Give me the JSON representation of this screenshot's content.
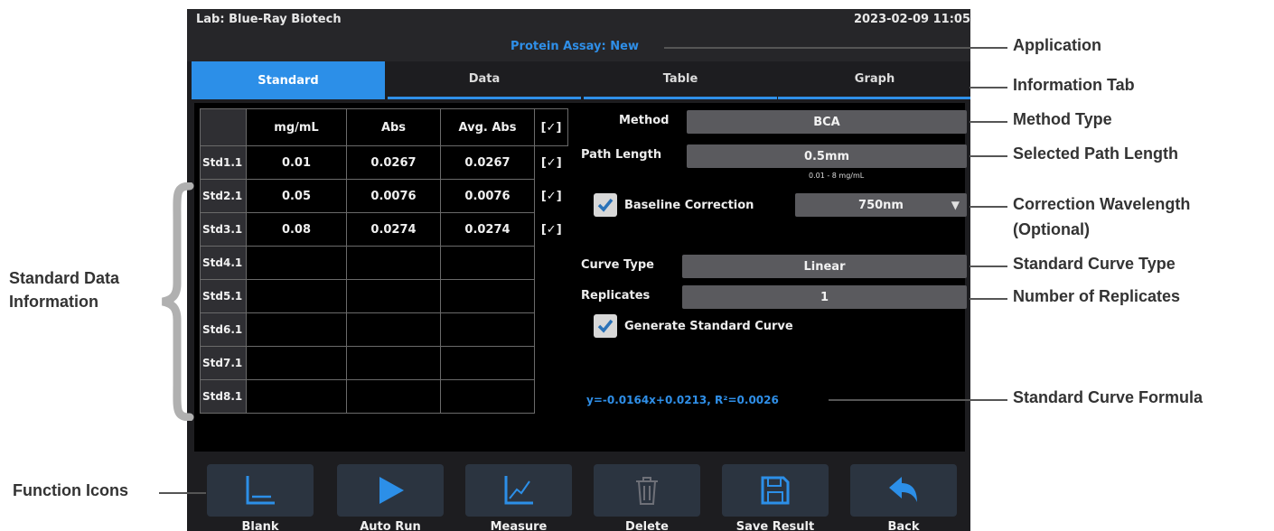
{
  "header": {
    "lab": "Lab: Blue-Ray Biotech",
    "datetime": "2023-02-09 11:05",
    "application": "Protein Assay: New"
  },
  "tabs": [
    {
      "label": "Standard",
      "active": true
    },
    {
      "label": "Data",
      "active": false
    },
    {
      "label": "Table",
      "active": false
    },
    {
      "label": "Graph",
      "active": false
    }
  ],
  "table": {
    "headers": [
      "",
      "mg/mL",
      "Abs",
      "Avg. Abs",
      "[✓]"
    ],
    "rows": [
      {
        "id": "Std1.1",
        "conc": "0.01",
        "abs": "0.0267",
        "avg": "0.0267",
        "check": "[✓]"
      },
      {
        "id": "Std2.1",
        "conc": "0.05",
        "abs": "0.0076",
        "avg": "0.0076",
        "check": "[✓]"
      },
      {
        "id": "Std3.1",
        "conc": "0.08",
        "abs": "0.0274",
        "avg": "0.0274",
        "check": "[✓]"
      },
      {
        "id": "Std4.1",
        "conc": "",
        "abs": "",
        "avg": "",
        "check": ""
      },
      {
        "id": "Std5.1",
        "conc": "",
        "abs": "",
        "avg": "",
        "check": ""
      },
      {
        "id": "Std6.1",
        "conc": "",
        "abs": "",
        "avg": "",
        "check": ""
      },
      {
        "id": "Std7.1",
        "conc": "",
        "abs": "",
        "avg": "",
        "check": ""
      },
      {
        "id": "Std8.1",
        "conc": "",
        "abs": "",
        "avg": "",
        "check": ""
      }
    ]
  },
  "settings": {
    "method_label": "Method",
    "method_value": "BCA",
    "path_label": "Path Length",
    "path_value": "0.5mm",
    "range_hint": "0.01 - 8 mg/mL",
    "baseline_label": "Baseline Correction",
    "baseline_checked": true,
    "baseline_value": "750nm",
    "curve_label": "Curve Type",
    "curve_value": "Linear",
    "replicates_label": "Replicates",
    "replicates_value": "1",
    "generate_label": "Generate Standard Curve",
    "generate_checked": true,
    "formula": "y=-0.0164x+0.0213, R²=0.0026"
  },
  "functions": [
    {
      "label": "Blank",
      "icon": "blank-axis-icon",
      "enabled": true
    },
    {
      "label": "Auto Run",
      "icon": "play-icon",
      "enabled": true
    },
    {
      "label": "Measure",
      "icon": "measure-chart-icon",
      "enabled": true
    },
    {
      "label": "Delete",
      "icon": "trash-icon",
      "enabled": false
    },
    {
      "label": "Save Result",
      "icon": "save-icon",
      "enabled": true
    },
    {
      "label": "Back",
      "icon": "back-arrow-icon",
      "enabled": true
    }
  ],
  "annotations": {
    "application": "Application",
    "info_tab": "Information Tab",
    "method_type": "Method Type",
    "path_length": "Selected Path Length",
    "correction_1": "Correction Wavelength",
    "correction_2": "(Optional)",
    "curve_type": "Standard Curve Type",
    "replicates": "Number of Replicates",
    "formula": "Standard Curve Formula",
    "std_data_1": "Standard Data",
    "std_data_2": "Information",
    "function_icons": "Function Icons"
  },
  "colors": {
    "accent": "#2c8fe8",
    "screen_bg": "#1d1d20",
    "field_bg": "#5a5a5e",
    "button_bg": "#2b3440"
  }
}
